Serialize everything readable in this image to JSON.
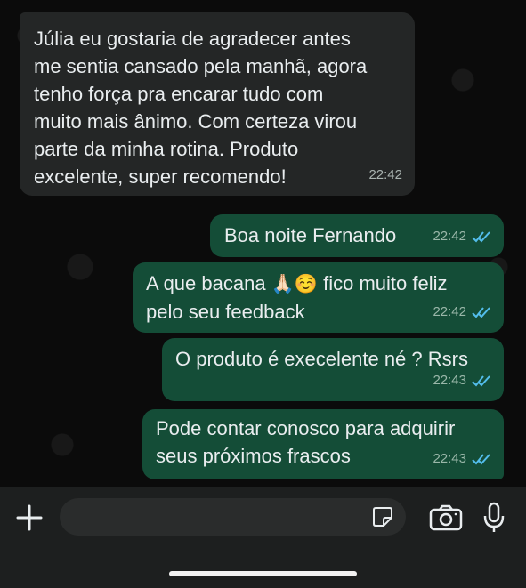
{
  "messages": [
    {
      "direction": "incoming",
      "text": "Júlia eu gostaria de agradecer antes\nme sentia cansado pela manhã, agora\ntenho força pra encarar tudo com\nmuito mais ânimo. Com certeza virou\nparte da minha rotina. Produto\nexcelente, super recomendo!",
      "time": "22:42"
    },
    {
      "direction": "outgoing",
      "text": "Boa noite Fernando",
      "time": "22:42",
      "status": "read"
    },
    {
      "direction": "outgoing",
      "text_before_emoji": "A que bacana ",
      "emoji": "🙏🏻☺️",
      "text_after_emoji": " fico muito feliz\npelo seu feedback",
      "time": "22:42",
      "status": "read"
    },
    {
      "direction": "outgoing",
      "text": "O produto é execelente né ? Rsrs",
      "time": "22:43",
      "status": "read"
    },
    {
      "direction": "outgoing",
      "text": "Pode contar conosco para adquirir\nseus próximos frascos",
      "time": "22:43",
      "status": "read"
    }
  ],
  "composer": {
    "placeholder": "",
    "icons": [
      "plus-icon",
      "sticker-icon",
      "camera-icon",
      "microphone-icon"
    ]
  },
  "colors": {
    "incoming_bubble": "#242626",
    "outgoing_bubble": "#144d37",
    "read_tick": "#53bdeb",
    "background": "#0b0b0b"
  }
}
